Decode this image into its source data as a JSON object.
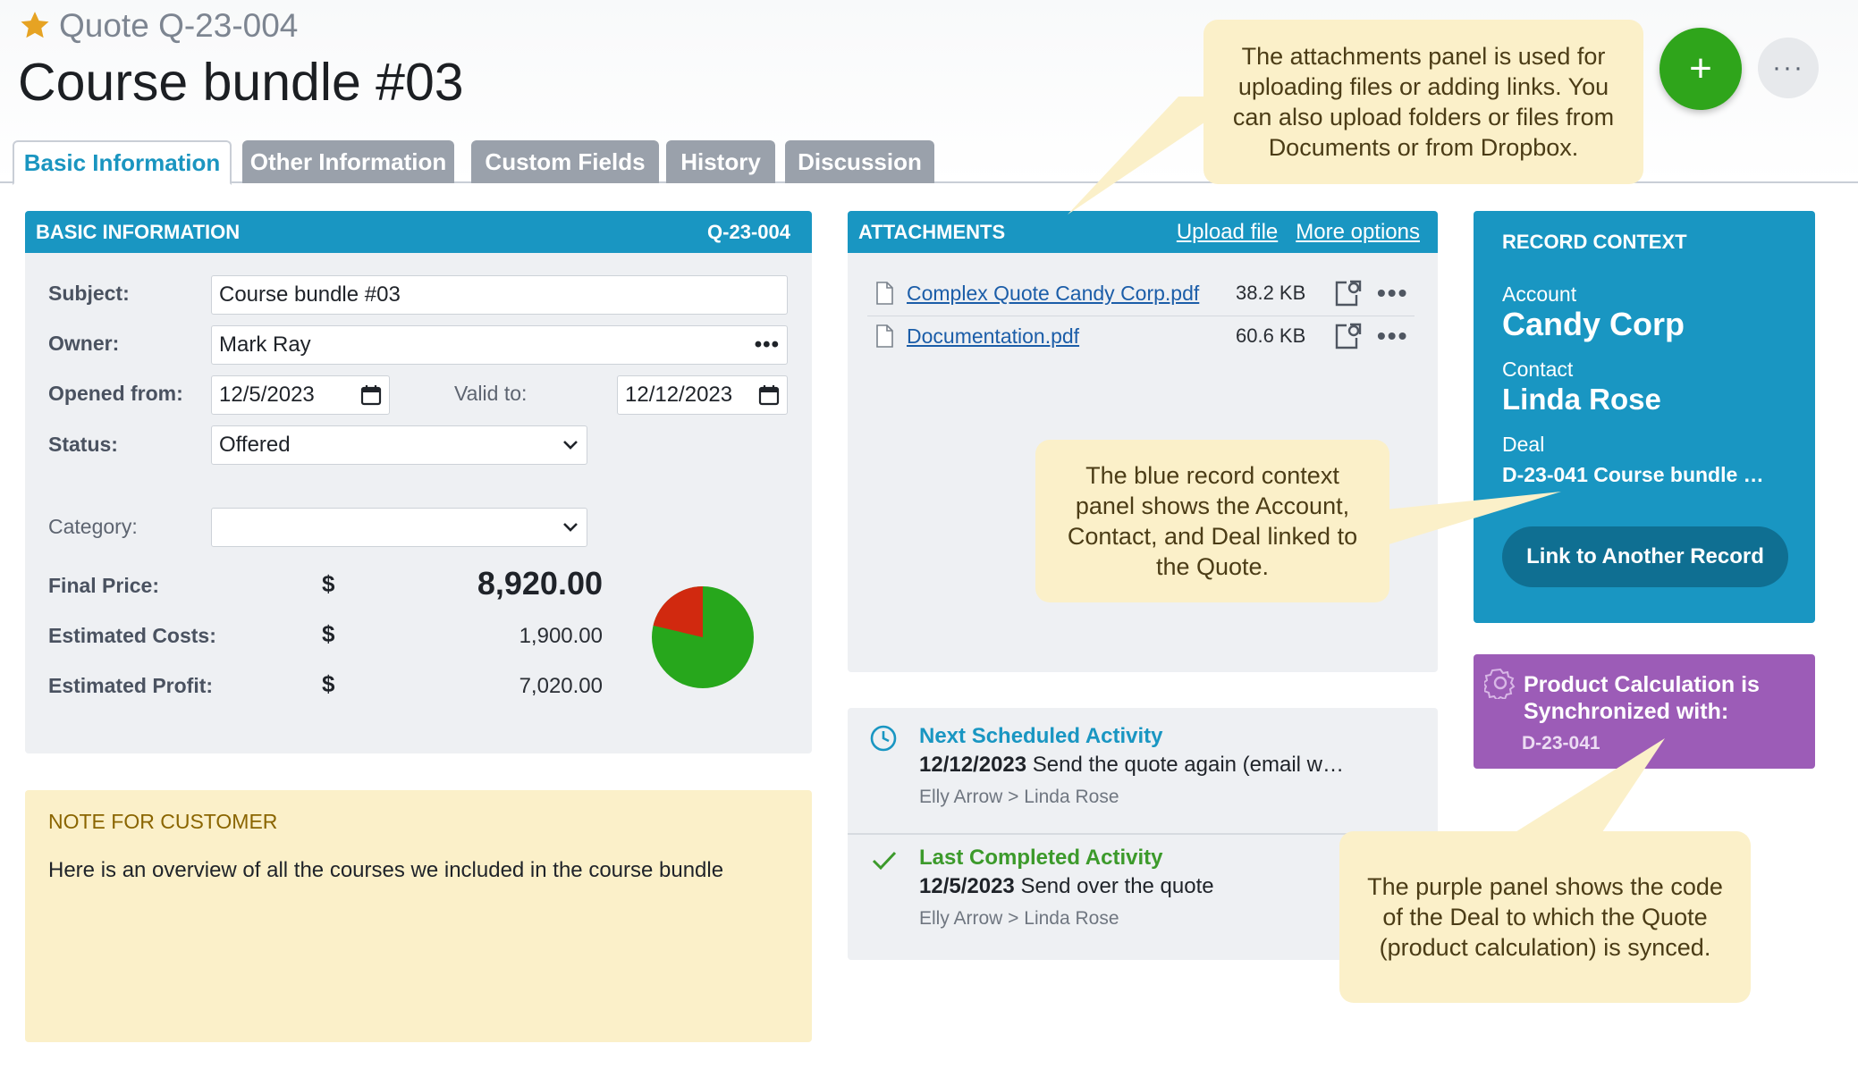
{
  "header": {
    "record_code": "Quote Q-23-004",
    "title": "Course bundle #03",
    "add_label": "+",
    "more_label": "···"
  },
  "tabs": [
    {
      "label": "Basic Information",
      "active": true
    },
    {
      "label": "Other Information"
    },
    {
      "label": "Custom Fields"
    },
    {
      "label": "History"
    },
    {
      "label": "Discussion"
    }
  ],
  "basic_info": {
    "heading": "BASIC INFORMATION",
    "code": "Q-23-004",
    "subject_label": "Subject:",
    "subject_value": "Course bundle #03",
    "owner_label": "Owner:",
    "owner_value": "Mark Ray",
    "owner_more": "•••",
    "opened_label": "Opened from:",
    "opened_value": "12/5/2023",
    "valid_label": "Valid to:",
    "valid_value": "12/12/2023",
    "status_label": "Status:",
    "status_value": "Offered",
    "category_label": "Category:",
    "category_value": "",
    "currency": "$",
    "final_price_label": "Final Price:",
    "final_price_value": "8,920.00",
    "est_costs_label": "Estimated Costs:",
    "est_costs_value": "1,900.00",
    "est_profit_label": "Estimated Profit:",
    "est_profit_value": "7,020.00",
    "pie": {
      "costs": 1900,
      "profit": 7020,
      "costs_color": "#d1290f",
      "profit_color": "#27a71c"
    }
  },
  "note": {
    "heading": "NOTE FOR CUSTOMER",
    "text": "Here is an overview of all the courses we included in the course bundle"
  },
  "attachments": {
    "heading": "ATTACHMENTS",
    "upload_label": "Upload file",
    "more_options_label": "More options",
    "files": [
      {
        "name": "Complex Quote Candy Corp.pdf",
        "size": "38.2 KB"
      },
      {
        "name": "Documentation.pdf",
        "size": "60.6 KB"
      }
    ]
  },
  "activity": {
    "next_title": "Next Scheduled Activity",
    "next_date": "12/12/2023",
    "next_text": " Send the quote again (email w…",
    "next_people": "Elly Arrow > Linda Rose",
    "last_title": "Last Completed Activity",
    "last_date": "12/5/2023",
    "last_text": " Send over the quote",
    "last_people": "Elly Arrow > Linda Rose",
    "next_color": "#1996c2",
    "last_color": "#3c9a2b"
  },
  "record_context": {
    "heading": "RECORD CONTEXT",
    "account_label": "Account",
    "account_value": "Candy Corp",
    "contact_label": "Contact",
    "contact_value": "Linda Rose",
    "deal_label": "Deal",
    "deal_value": "D-23-041 Course bundle …",
    "link_button": "Link to Another Record"
  },
  "product_calc": {
    "title_line1": "Product Calculation is",
    "title_line2": "Synchronized with:",
    "code": "D-23-041"
  },
  "callouts": {
    "attachments": "The attachments panel is used for uploading files or adding links. You can also upload folders or files from Documents or from Dropbox.",
    "context": "The blue record context panel shows the Account, Contact, and Deal linked to the Quote.",
    "purple": "The purple panel shows the code of the Deal to which the Quote (product calculation) is synced."
  }
}
